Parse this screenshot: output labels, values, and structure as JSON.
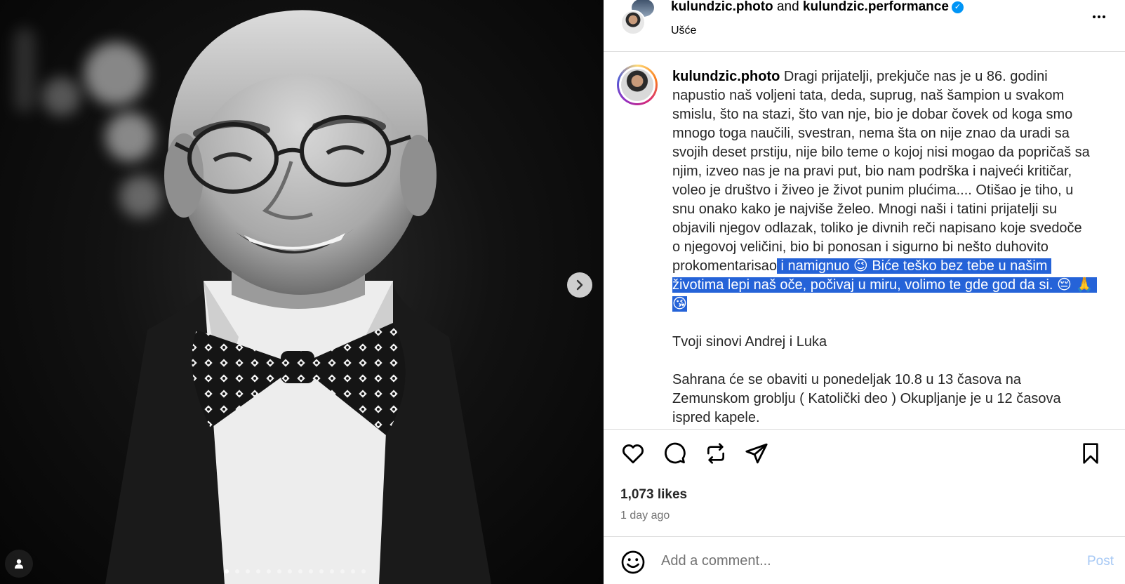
{
  "header": {
    "user_primary": "kulundzic.photo",
    "joiner": "and",
    "user_secondary": "kulundzic.performance",
    "verified_icon": "verified-badge-icon",
    "location": "Ušće",
    "more_icon": "more-options-icon"
  },
  "caption": {
    "username": "kulundzic.photo",
    "text_before_selection": "Dragi prijatelji, prekjuče nas je u 86. godini napustio naš voljeni tata, deda, suprug, naš šampion u svakom smislu, što na stazi, što van nje, bio je dobar čovek od koga smo mnogo toga naučili, svestran, nema šta on nije znao da uradi sa svojih deset prstiju, nije bilo teme o kojoj nisi mogao da popričaš sa njim, izveo nas je na pravi put, bio nam podrška i najveći kritičar, voleo je društvo i živeo je život punim plućima.... Otišao je tiho, u snu onako kako je najviše želeo. Mnogi naši i tatini prijatelji su objavili njegov odlazak, toliko je divnih reči napisano koje svedoče o njegovoj veličini, bio bi ponosan i sigurno bi nešto duhovito prokomentarisao",
    "text_selected": " i namignuo 😉 Biće teško bez tebe u našim životima lepi naš oče, počivaj u miru, volimo te gde god da si. 😔 🙏 😘",
    "signoff": "Tvoji sinovi Andrej i Luka",
    "funeral": "Sahrana će se obaviti u ponedeljak 10.8 u 13 časova na Zemunskom groblju ( Katolički deo ) Okupljanje je u 12 časova ispred kapele."
  },
  "actions": {
    "like_icon": "heart-icon",
    "comment_icon": "comment-icon",
    "repost_icon": "repost-icon",
    "share_icon": "share-icon",
    "save_icon": "bookmark-icon",
    "likes": "1,073 likes",
    "time": "1 day ago"
  },
  "comment": {
    "emoji_icon": "emoji-icon",
    "placeholder": "Add a comment...",
    "post_label": "Post"
  },
  "media": {
    "next_icon": "chevron-right-icon",
    "tags_icon": "user-tag-icon",
    "dot_count": 14,
    "active_dot": 0
  },
  "colors": {
    "selection": "#2563d8",
    "verified": "#0095f6",
    "post_disabled": "#a7c9f5"
  }
}
